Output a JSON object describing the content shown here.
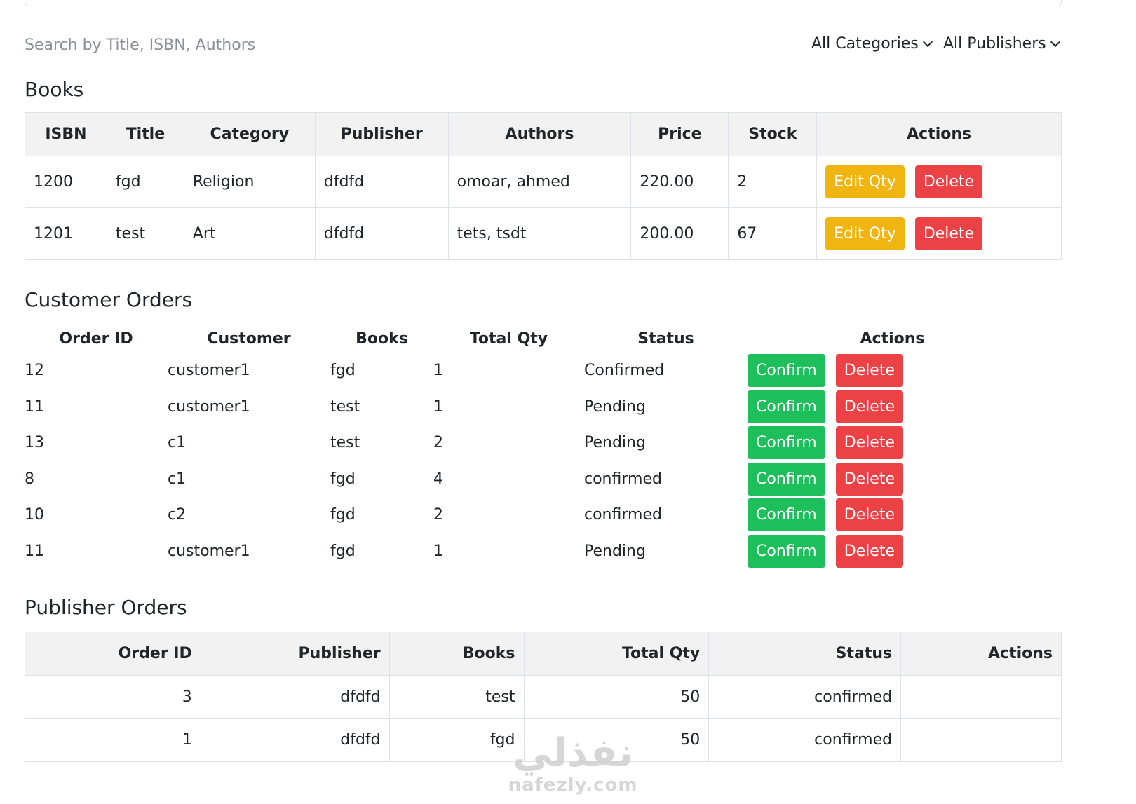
{
  "filters": {
    "search_placeholder": "Search by Title, ISBN, Authors",
    "category_select": "All Categories",
    "publisher_select": "All Publishers"
  },
  "books": {
    "title": "Books",
    "headers": [
      "ISBN",
      "Title",
      "Category",
      "Publisher",
      "Authors",
      "Price",
      "Stock",
      "Actions"
    ],
    "rows": [
      {
        "isbn": "1200",
        "title": "fgd",
        "category": "Religion",
        "publisher": "dfdfd",
        "authors": "omoar, ahmed",
        "price": "220.00",
        "stock": "2"
      },
      {
        "isbn": "1201",
        "title": "test",
        "category": "Art",
        "publisher": "dfdfd",
        "authors": "tets, tsdt",
        "price": "200.00",
        "stock": "67"
      }
    ],
    "edit_label": "Edit Qty",
    "delete_label": "Delete"
  },
  "customer_orders": {
    "title": "Customer Orders",
    "headers": [
      "Order ID",
      "Customer",
      "Books",
      "Total Qty",
      "Status",
      "Actions"
    ],
    "rows": [
      {
        "order_id": "12",
        "customer": "customer1",
        "books": "fgd",
        "qty": "1",
        "status": "Confirmed"
      },
      {
        "order_id": "11",
        "customer": "customer1",
        "books": "test",
        "qty": "1",
        "status": "Pending"
      },
      {
        "order_id": "13",
        "customer": "c1",
        "books": "test",
        "qty": "2",
        "status": "Pending"
      },
      {
        "order_id": "8",
        "customer": "c1",
        "books": "fgd",
        "qty": "4",
        "status": "confirmed"
      },
      {
        "order_id": "10",
        "customer": "c2",
        "books": "fgd",
        "qty": "2",
        "status": "confirmed"
      },
      {
        "order_id": "11",
        "customer": "customer1",
        "books": "fgd",
        "qty": "1",
        "status": "Pending"
      }
    ],
    "confirm_label": "Confirm",
    "delete_label": "Delete"
  },
  "publisher_orders": {
    "title": "Publisher Orders",
    "headers": [
      "Order ID",
      "Publisher",
      "Books",
      "Total Qty",
      "Status",
      "Actions"
    ],
    "rows": [
      {
        "order_id": "3",
        "publisher": "dfdfd",
        "books": "test",
        "qty": "50",
        "status": "confirmed"
      },
      {
        "order_id": "1",
        "publisher": "dfdfd",
        "books": "fgd",
        "qty": "50",
        "status": "confirmed"
      }
    ]
  },
  "watermark": {
    "arabic": "نفذلي",
    "latin": "nafezly.com"
  }
}
